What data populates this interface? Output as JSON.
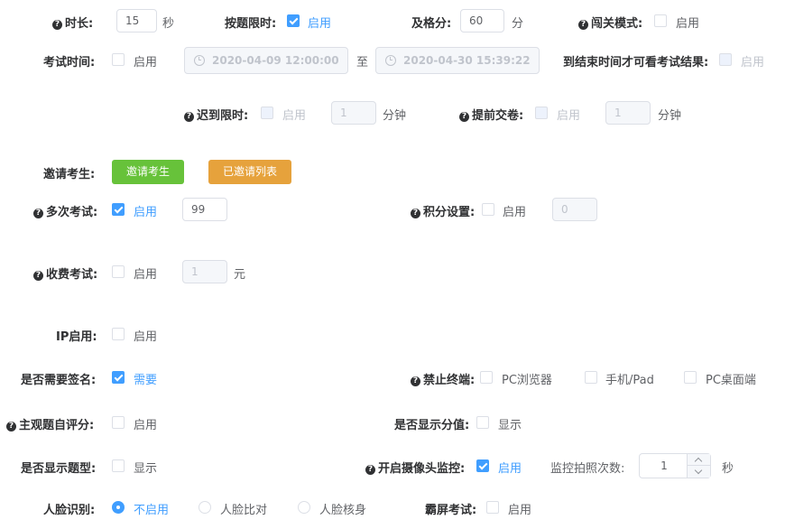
{
  "row1": {
    "duration": {
      "label": "时长:",
      "value": "15",
      "unit": "秒"
    },
    "per_question_limit": {
      "label": "按题限时:",
      "option": "启用"
    },
    "pass_score": {
      "label": "及格分:",
      "value": "60",
      "unit": "分"
    },
    "level_mode": {
      "label": "闯关模式:",
      "option": "启用"
    }
  },
  "exam_time": {
    "label": "考试时间:",
    "option": "启用",
    "start": "2020-04-09 12:00:00",
    "to": "至",
    "end": "2020-04-30 15:39:22",
    "show_result_label": "到结束时间才可看考试结果:",
    "show_result_option": "启用"
  },
  "late_limit": {
    "label": "迟到限时:",
    "option": "启用",
    "value": "1",
    "unit": "分钟"
  },
  "early_submit": {
    "label": "提前交卷:",
    "option": "启用",
    "value": "1",
    "unit": "分钟"
  },
  "invite": {
    "label": "邀请考生:",
    "invite_button": "邀请考生",
    "list_button": "已邀请列表"
  },
  "multi_exam": {
    "label": "多次考试:",
    "option": "启用",
    "value": "99"
  },
  "points": {
    "label": "积分设置:",
    "option": "启用",
    "value": "0"
  },
  "fee_exam": {
    "label": "收费考试:",
    "option": "启用",
    "value": "1",
    "unit": "元"
  },
  "ip": {
    "label": "IP启用:",
    "option": "启用"
  },
  "signature": {
    "label": "是否需要签名:",
    "option": "需要"
  },
  "ban_terminal": {
    "label": "禁止终端:",
    "options": [
      "PC浏览器",
      "手机/Pad",
      "PC桌面端"
    ]
  },
  "subjective_self": {
    "label": "主观题自评分:",
    "option": "启用"
  },
  "show_score": {
    "label": "是否显示分值:",
    "option": "显示"
  },
  "show_type": {
    "label": "是否显示题型:",
    "option": "显示"
  },
  "camera": {
    "label": "开启摄像头监控:",
    "option": "启用",
    "shots_label": "监控拍照次数:",
    "shots_value": "1",
    "unit": "秒"
  },
  "face": {
    "label": "人脸识别:",
    "options": [
      "不启用",
      "人脸比对",
      "人脸核身"
    ]
  },
  "full_screen": {
    "label": "霸屏考试:",
    "option": "启用"
  },
  "colors": {
    "primary": "#409eff",
    "success": "#67c23a",
    "warning": "#e6a23c"
  }
}
